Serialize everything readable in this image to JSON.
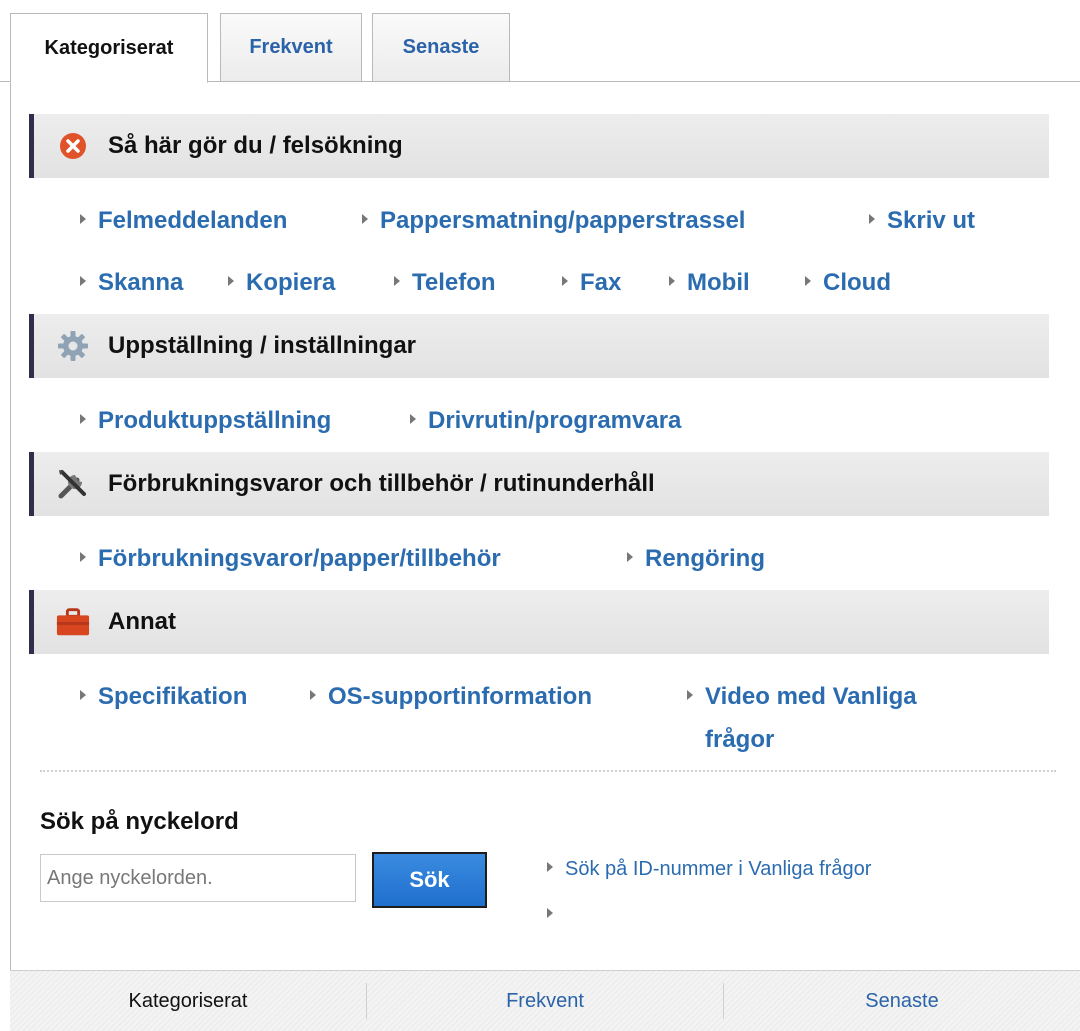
{
  "tabs": {
    "items": [
      {
        "label": "Kategoriserat"
      },
      {
        "label": "Frekvent"
      },
      {
        "label": "Senaste"
      }
    ]
  },
  "sections": [
    {
      "title": "Så här gör du / felsökning",
      "icon": "error-x-icon",
      "links": [
        "Felmeddelanden",
        "Pappersmatning/papperstrassel",
        "Skriv ut",
        "Skanna",
        "Kopiera",
        "Telefon",
        "Fax",
        "Mobil",
        "Cloud"
      ]
    },
    {
      "title": "Uppställning / inställningar",
      "icon": "gear-icon",
      "links": [
        "Produktuppställning",
        "Drivrutin/programvara"
      ]
    },
    {
      "title": "Förbrukningsvaror och tillbehör / rutinunderhåll",
      "icon": "tools-icon",
      "links": [
        "Förbrukningsvaror/papper/tillbehör",
        "Rengöring"
      ]
    },
    {
      "title": "Annat",
      "icon": "toolbox-icon",
      "links": [
        "Specifikation",
        "OS-supportinformation",
        "Video med Vanliga",
        "frågor"
      ]
    }
  ],
  "search": {
    "title": "Sök på nyckelord",
    "placeholder": "Ange nyckelorden.",
    "button": "Sök",
    "id_link": "Sök på ID-nummer i Vanliga frågor"
  },
  "bottom_tabs": {
    "items": [
      {
        "label": "Kategoriserat"
      },
      {
        "label": "Frekvent"
      },
      {
        "label": "Senaste"
      }
    ]
  },
  "colors": {
    "link": "#2b6cb0",
    "header_bar": "#2f2f4b",
    "button": "#1f6fcd"
  }
}
